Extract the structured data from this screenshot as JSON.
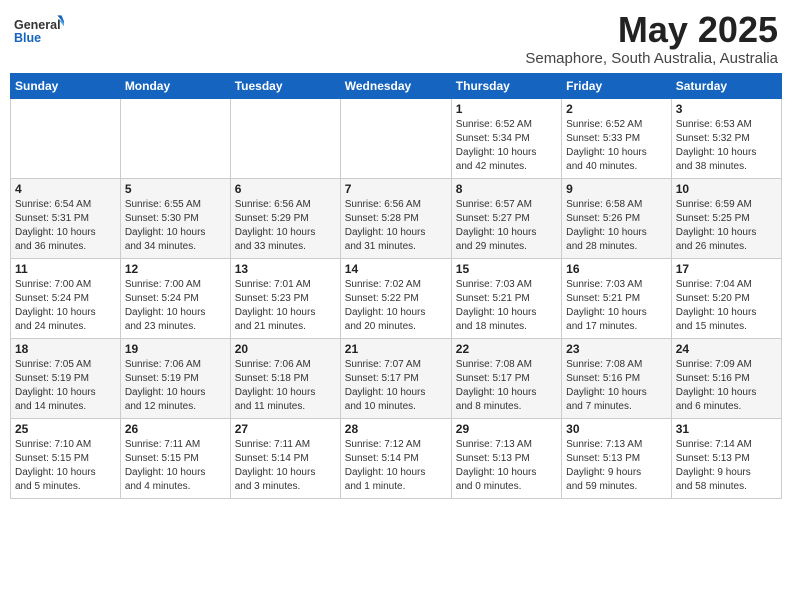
{
  "logo": {
    "general": "General",
    "blue": "Blue"
  },
  "header": {
    "month_year": "May 2025",
    "subtitle": "Semaphore, South Australia, Australia"
  },
  "days_of_week": [
    "Sunday",
    "Monday",
    "Tuesday",
    "Wednesday",
    "Thursday",
    "Friday",
    "Saturday"
  ],
  "weeks": [
    [
      {
        "day": "",
        "info": ""
      },
      {
        "day": "",
        "info": ""
      },
      {
        "day": "",
        "info": ""
      },
      {
        "day": "",
        "info": ""
      },
      {
        "day": "1",
        "info": "Sunrise: 6:52 AM\nSunset: 5:34 PM\nDaylight: 10 hours\nand 42 minutes."
      },
      {
        "day": "2",
        "info": "Sunrise: 6:52 AM\nSunset: 5:33 PM\nDaylight: 10 hours\nand 40 minutes."
      },
      {
        "day": "3",
        "info": "Sunrise: 6:53 AM\nSunset: 5:32 PM\nDaylight: 10 hours\nand 38 minutes."
      }
    ],
    [
      {
        "day": "4",
        "info": "Sunrise: 6:54 AM\nSunset: 5:31 PM\nDaylight: 10 hours\nand 36 minutes."
      },
      {
        "day": "5",
        "info": "Sunrise: 6:55 AM\nSunset: 5:30 PM\nDaylight: 10 hours\nand 34 minutes."
      },
      {
        "day": "6",
        "info": "Sunrise: 6:56 AM\nSunset: 5:29 PM\nDaylight: 10 hours\nand 33 minutes."
      },
      {
        "day": "7",
        "info": "Sunrise: 6:56 AM\nSunset: 5:28 PM\nDaylight: 10 hours\nand 31 minutes."
      },
      {
        "day": "8",
        "info": "Sunrise: 6:57 AM\nSunset: 5:27 PM\nDaylight: 10 hours\nand 29 minutes."
      },
      {
        "day": "9",
        "info": "Sunrise: 6:58 AM\nSunset: 5:26 PM\nDaylight: 10 hours\nand 28 minutes."
      },
      {
        "day": "10",
        "info": "Sunrise: 6:59 AM\nSunset: 5:25 PM\nDaylight: 10 hours\nand 26 minutes."
      }
    ],
    [
      {
        "day": "11",
        "info": "Sunrise: 7:00 AM\nSunset: 5:24 PM\nDaylight: 10 hours\nand 24 minutes."
      },
      {
        "day": "12",
        "info": "Sunrise: 7:00 AM\nSunset: 5:24 PM\nDaylight: 10 hours\nand 23 minutes."
      },
      {
        "day": "13",
        "info": "Sunrise: 7:01 AM\nSunset: 5:23 PM\nDaylight: 10 hours\nand 21 minutes."
      },
      {
        "day": "14",
        "info": "Sunrise: 7:02 AM\nSunset: 5:22 PM\nDaylight: 10 hours\nand 20 minutes."
      },
      {
        "day": "15",
        "info": "Sunrise: 7:03 AM\nSunset: 5:21 PM\nDaylight: 10 hours\nand 18 minutes."
      },
      {
        "day": "16",
        "info": "Sunrise: 7:03 AM\nSunset: 5:21 PM\nDaylight: 10 hours\nand 17 minutes."
      },
      {
        "day": "17",
        "info": "Sunrise: 7:04 AM\nSunset: 5:20 PM\nDaylight: 10 hours\nand 15 minutes."
      }
    ],
    [
      {
        "day": "18",
        "info": "Sunrise: 7:05 AM\nSunset: 5:19 PM\nDaylight: 10 hours\nand 14 minutes."
      },
      {
        "day": "19",
        "info": "Sunrise: 7:06 AM\nSunset: 5:19 PM\nDaylight: 10 hours\nand 12 minutes."
      },
      {
        "day": "20",
        "info": "Sunrise: 7:06 AM\nSunset: 5:18 PM\nDaylight: 10 hours\nand 11 minutes."
      },
      {
        "day": "21",
        "info": "Sunrise: 7:07 AM\nSunset: 5:17 PM\nDaylight: 10 hours\nand 10 minutes."
      },
      {
        "day": "22",
        "info": "Sunrise: 7:08 AM\nSunset: 5:17 PM\nDaylight: 10 hours\nand 8 minutes."
      },
      {
        "day": "23",
        "info": "Sunrise: 7:08 AM\nSunset: 5:16 PM\nDaylight: 10 hours\nand 7 minutes."
      },
      {
        "day": "24",
        "info": "Sunrise: 7:09 AM\nSunset: 5:16 PM\nDaylight: 10 hours\nand 6 minutes."
      }
    ],
    [
      {
        "day": "25",
        "info": "Sunrise: 7:10 AM\nSunset: 5:15 PM\nDaylight: 10 hours\nand 5 minutes."
      },
      {
        "day": "26",
        "info": "Sunrise: 7:11 AM\nSunset: 5:15 PM\nDaylight: 10 hours\nand 4 minutes."
      },
      {
        "day": "27",
        "info": "Sunrise: 7:11 AM\nSunset: 5:14 PM\nDaylight: 10 hours\nand 3 minutes."
      },
      {
        "day": "28",
        "info": "Sunrise: 7:12 AM\nSunset: 5:14 PM\nDaylight: 10 hours\nand 1 minute."
      },
      {
        "day": "29",
        "info": "Sunrise: 7:13 AM\nSunset: 5:13 PM\nDaylight: 10 hours\nand 0 minutes."
      },
      {
        "day": "30",
        "info": "Sunrise: 7:13 AM\nSunset: 5:13 PM\nDaylight: 9 hours\nand 59 minutes."
      },
      {
        "day": "31",
        "info": "Sunrise: 7:14 AM\nSunset: 5:13 PM\nDaylight: 9 hours\nand 58 minutes."
      }
    ]
  ]
}
